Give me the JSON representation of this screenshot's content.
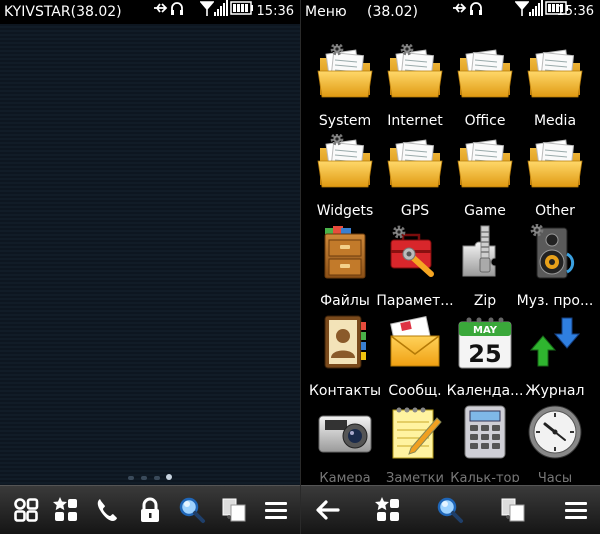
{
  "home": {
    "status": {
      "operator": "KYIVSTAR",
      "code": "(38.02)",
      "time": "15:36"
    },
    "page_indicator": {
      "total": 4,
      "active": 4
    },
    "toolbar": [
      "apps-grid-icon",
      "favorites-icon",
      "phone-icon",
      "lock-icon",
      "search-icon",
      "switch-apps-icon",
      "options-icon"
    ]
  },
  "menu": {
    "status": {
      "title": "Меню",
      "code": "(38.02)",
      "time": "15:36"
    },
    "items": [
      {
        "label": "System",
        "icon": "folder-gear-icon"
      },
      {
        "label": "Internet",
        "icon": "folder-gear-icon"
      },
      {
        "label": "Office",
        "icon": "folder-icon"
      },
      {
        "label": "Media",
        "icon": "folder-icon"
      },
      {
        "label": "Widgets",
        "icon": "folder-gear-icon"
      },
      {
        "label": "GPS",
        "icon": "folder-icon"
      },
      {
        "label": "Game",
        "icon": "folder-icon"
      },
      {
        "label": "Other",
        "icon": "folder-icon"
      },
      {
        "label": "Файлы",
        "icon": "file-manager-icon"
      },
      {
        "label": "Парамет...",
        "icon": "settings-toolbox-icon"
      },
      {
        "label": "Zip",
        "icon": "zip-icon"
      },
      {
        "label": "Муз. про...",
        "icon": "music-player-icon"
      },
      {
        "label": "Контакты",
        "icon": "contacts-icon"
      },
      {
        "label": "Сообщ.",
        "icon": "messages-icon"
      },
      {
        "label": "Календа...",
        "icon": "calendar-icon"
      },
      {
        "label": "Журнал",
        "icon": "log-icon"
      },
      {
        "label": "Камера",
        "icon": "camera-icon"
      },
      {
        "label": "Заметки",
        "icon": "notes-icon"
      },
      {
        "label": "Кальк-тор",
        "icon": "calculator-icon"
      },
      {
        "label": "Часы",
        "icon": "clock-icon"
      }
    ],
    "calendar": {
      "month": "MAY",
      "day": "25"
    },
    "toolbar": [
      "back-arrow-icon",
      "favorites-icon",
      "search-icon",
      "switch-apps-icon",
      "options-icon"
    ]
  },
  "colors": {
    "home_bg": "#0d1620",
    "folder": "#f3b431",
    "toolbar": "#2a2a2a"
  }
}
